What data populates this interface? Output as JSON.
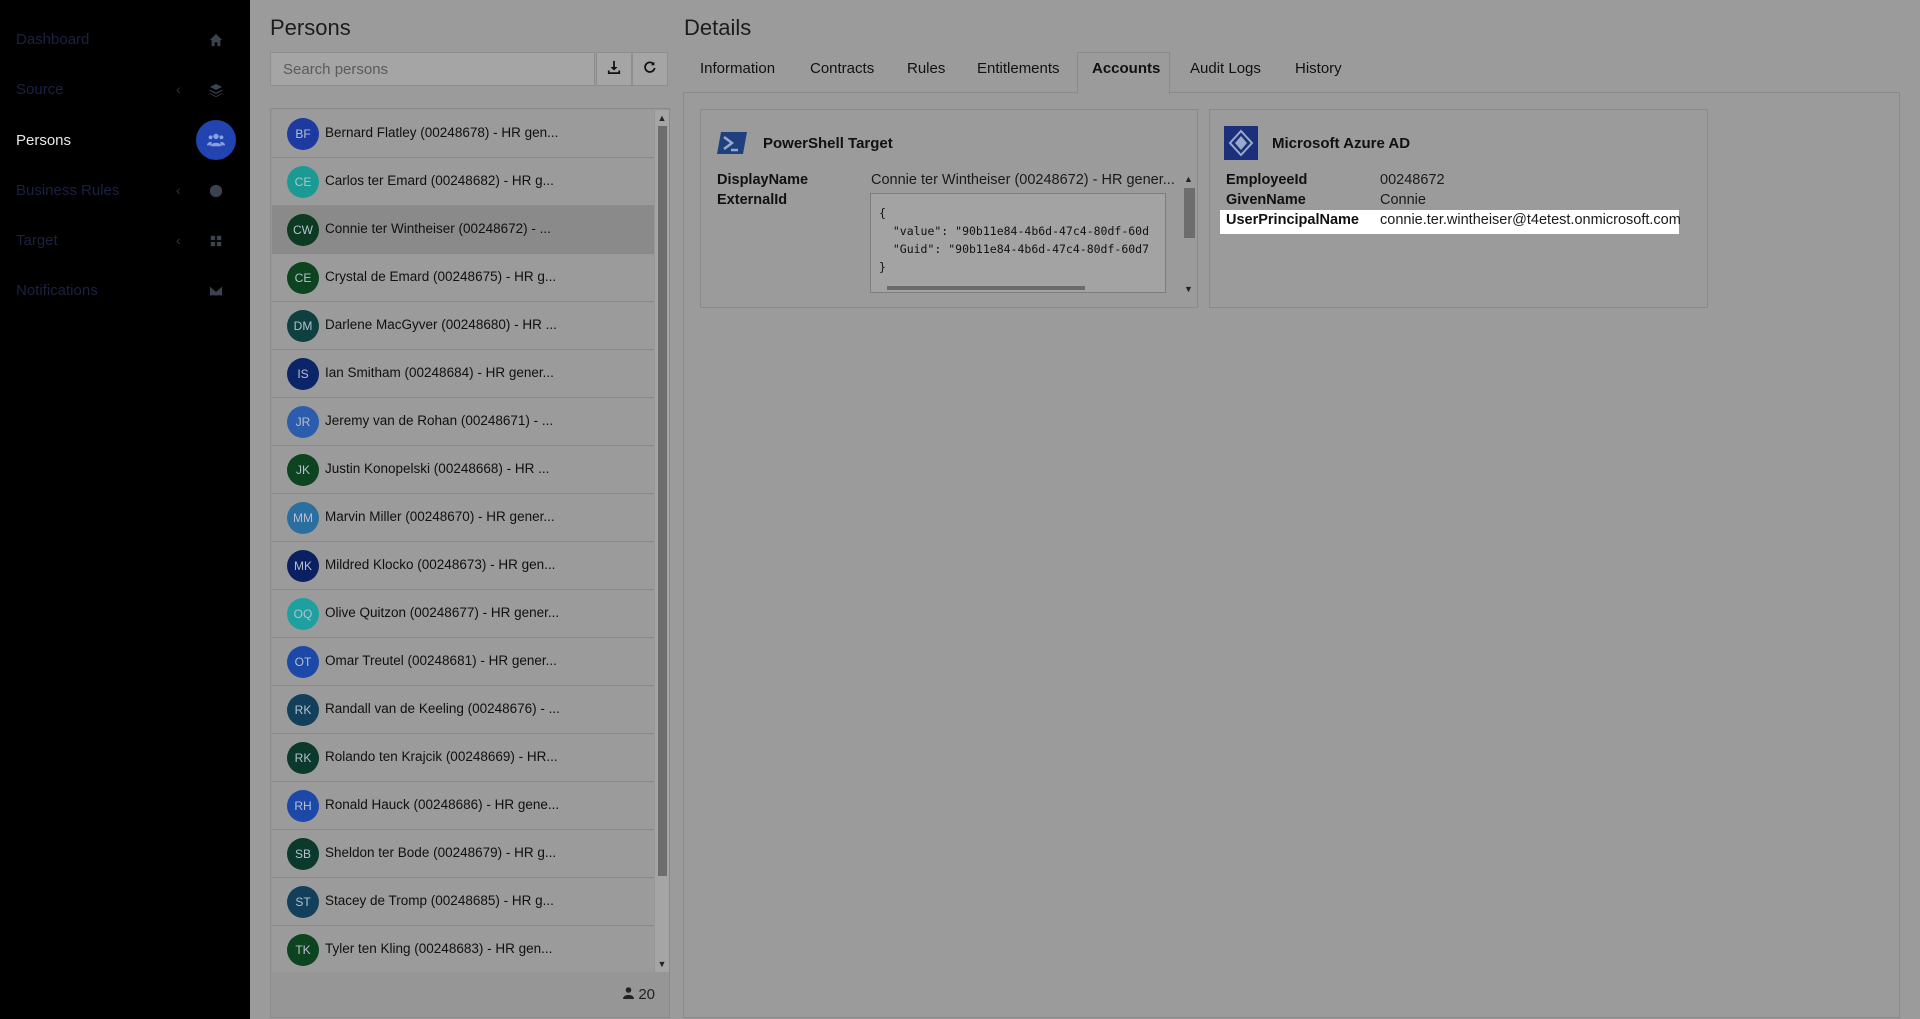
{
  "sidebar": {
    "items": [
      {
        "label": "Dashboard",
        "icon": "home-icon",
        "chevron": false,
        "active": false
      },
      {
        "label": "Source",
        "icon": "database-icon",
        "chevron": true,
        "active": false
      },
      {
        "label": "Persons",
        "icon": "users-icon",
        "chevron": false,
        "active": true
      },
      {
        "label": "Business Rules",
        "icon": "globe-icon",
        "chevron": true,
        "active": false
      },
      {
        "label": "Target",
        "icon": "grid-icon",
        "chevron": true,
        "active": false
      },
      {
        "label": "Notifications",
        "icon": "envelope-icon",
        "chevron": false,
        "active": false
      }
    ],
    "chevron_glyph": "‹"
  },
  "persons": {
    "title": "Persons",
    "search_placeholder": "Search persons",
    "count": "20",
    "items": [
      {
        "initials": "BF",
        "name": "Bernard Flatley (00248678) - HR gen...",
        "color": "#1c3aa0"
      },
      {
        "initials": "CE",
        "name": "Carlos ter Emard (00248682) - HR g...",
        "color": "#1a9a93"
      },
      {
        "initials": "CW",
        "name": "Connie ter Wintheiser (00248672) - ...",
        "color": "#0d3a22"
      },
      {
        "initials": "CE",
        "name": "Crystal de Emard (00248675) - HR g...",
        "color": "#0c4420"
      },
      {
        "initials": "DM",
        "name": "Darlene MacGyver (00248680) - HR ...",
        "color": "#0f4040"
      },
      {
        "initials": "IS",
        "name": "Ian Smitham (00248684) - HR gener...",
        "color": "#0c2468"
      },
      {
        "initials": "JR",
        "name": "Jeremy van de Rohan (00248671) - ...",
        "color": "#2c5cae"
      },
      {
        "initials": "JK",
        "name": "Justin Konopelski (00248668) - HR ...",
        "color": "#0c4420"
      },
      {
        "initials": "MM",
        "name": "Marvin Miller (00248670) - HR gener...",
        "color": "#2a6fa0"
      },
      {
        "initials": "MK",
        "name": "Mildred Klocko (00248673) - HR gen...",
        "color": "#0b2060"
      },
      {
        "initials": "OQ",
        "name": "Olive Quitzon (00248677) - HR gener...",
        "color": "#1fa0a0"
      },
      {
        "initials": "OT",
        "name": "Omar Treutel (00248681) - HR gener...",
        "color": "#1c48a8"
      },
      {
        "initials": "RK",
        "name": "Randall van de Keeling (00248676) - ...",
        "color": "#12405a"
      },
      {
        "initials": "RK",
        "name": "Rolando ten Krajcik (00248669) - HR...",
        "color": "#0b3a2c"
      },
      {
        "initials": "RH",
        "name": "Ronald Hauck (00248686) - HR gene...",
        "color": "#1c48a8"
      },
      {
        "initials": "SB",
        "name": "Sheldon ter Bode (00248679) - HR g...",
        "color": "#0b3a2c"
      },
      {
        "initials": "ST",
        "name": "Stacey de Tromp (00248685) - HR g...",
        "color": "#12405a"
      },
      {
        "initials": "TK",
        "name": "Tyler ten Kling (00248683) - HR gen...",
        "color": "#0c4420"
      }
    ],
    "selected_index": 2
  },
  "details": {
    "title": "Details",
    "tabs": [
      "Information",
      "Contracts",
      "Rules",
      "Entitlements",
      "Accounts",
      "Audit Logs",
      "History"
    ],
    "active_tab": "Accounts",
    "powershell": {
      "title": "PowerShell Target",
      "display_name_key": "DisplayName",
      "display_name_val": "Connie ter Wintheiser (00248672) - HR gener...",
      "external_id_key": "ExternalId",
      "code_lines": [
        "{",
        "  \"value\": \"90b11e84-4b6d-47c4-80df-60d",
        "  \"Guid\": \"90b11e84-4b6d-47c4-80df-60d7",
        "}"
      ]
    },
    "azure": {
      "title": "Microsoft Azure AD",
      "fields": [
        {
          "key": "EmployeeId",
          "value": "00248672"
        },
        {
          "key": "GivenName",
          "value": "Connie"
        },
        {
          "key": "UserPrincipalName",
          "value": "connie.ter.wintheiser@t4etest.onmicrosoft.com"
        }
      ]
    }
  },
  "colors": {
    "powershell_blue": "#1f3f7f",
    "azure_blue": "#1c2f7a",
    "accent": "#2144b0"
  }
}
